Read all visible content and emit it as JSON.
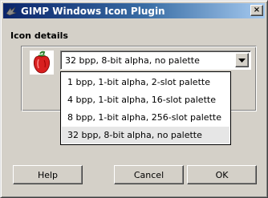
{
  "window": {
    "title": "GIMP Windows Icon Plugin",
    "icon": "gimp-wilber-icon",
    "close_label": "×"
  },
  "section": {
    "label": "Icon details"
  },
  "icon_entry": {
    "thumbnail": "red-pepper-icon",
    "combo": {
      "selected": "32 bpp, 8-bit alpha, no palette",
      "options": [
        "1 bpp, 1-bit alpha, 2-slot palette",
        "4 bpp, 1-bit alpha, 16-slot palette",
        "8 bpp, 1-bit alpha, 256-slot palette",
        "32 bpp, 8-bit alpha, no palette"
      ]
    }
  },
  "buttons": {
    "help": "Help",
    "cancel": "Cancel",
    "ok": "OK"
  }
}
